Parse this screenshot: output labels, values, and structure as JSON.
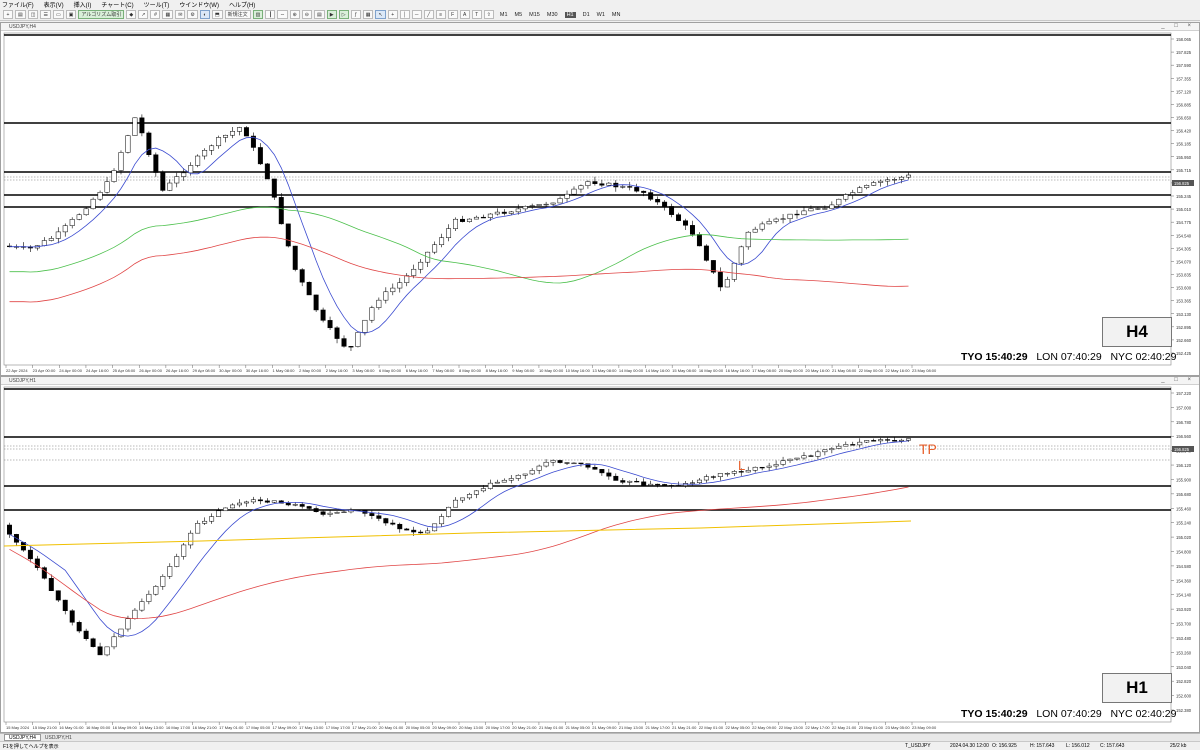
{
  "menu": [
    "ファイル(F)",
    "表示(V)",
    "挿入(I)",
    "チャート(C)",
    "ツール(T)",
    "ウインドウ(W)",
    "ヘルプ(H)"
  ],
  "toolbar": {
    "autotrade_label": "アルゴリズム取引",
    "ordernew_label": "新規注文",
    "timeframes": [
      "M1",
      "M5",
      "M15",
      "M30",
      "H1",
      "D1",
      "W1",
      "MN"
    ],
    "active_timeframe": "H1"
  },
  "top_chart": {
    "window_title": "USDJPY,H4",
    "timeframe_label": "H4",
    "clock": {
      "tyo_label": "TYO",
      "tyo_time": "15:40:29",
      "lon_label": "LON",
      "lon_time": "07:40:29",
      "nyc_label": "NYC",
      "nyc_time": "02:40:29"
    },
    "price_labels": [
      "158.065",
      "157.825",
      "157.590",
      "157.355",
      "157.120",
      "156.885",
      "156.650",
      "156.420",
      "156.185",
      "155.950",
      "155.715",
      "155.480",
      "155.245",
      "155.010",
      "154.775",
      "154.540",
      "154.305",
      "154.070",
      "153.835",
      "153.600",
      "153.365",
      "153.130",
      "152.895",
      "152.660",
      "152.425"
    ],
    "current_price": "156.825",
    "time_labels": [
      "22 Apr 2024",
      "23 Apr 00:00",
      "24 Apr 00:00",
      "24 Apr 16:00",
      "25 Apr 08:00",
      "26 Apr 00:00",
      "26 Apr 16:00",
      "29 Apr 08:00",
      "30 Apr 00:00",
      "30 Apr 16:00",
      "1 May 08:00",
      "2 May 00:00",
      "2 May 16:00",
      "3 May 08:00",
      "6 May 00:00",
      "6 May 16:00",
      "7 May 08:00",
      "8 May 00:00",
      "8 May 16:00",
      "9 May 08:00",
      "10 May 00:00",
      "10 May 16:00",
      "13 May 08:00",
      "14 May 00:00",
      "14 May 16:00",
      "15 May 08:00",
      "16 May 00:00",
      "16 May 16:00",
      "17 May 08:00",
      "20 May 00:00",
      "20 May 16:00",
      "21 May 08:00",
      "22 May 00:00",
      "22 May 16:00",
      "23 May 08:00"
    ]
  },
  "bottom_chart": {
    "window_title": "USDJPY,H1",
    "timeframe_label": "H1",
    "clock": {
      "tyo_label": "TYO",
      "tyo_time": "15:40:29",
      "lon_label": "LON",
      "lon_time": "07:40:29",
      "nyc_label": "NYC",
      "nyc_time": "02:40:29"
    },
    "price_labels": [
      "157.220",
      "157.000",
      "156.780",
      "156.560",
      "156.340",
      "156.120",
      "155.900",
      "155.680",
      "155.460",
      "155.240",
      "155.020",
      "154.800",
      "154.580",
      "154.360",
      "154.140",
      "153.920",
      "153.700",
      "153.480",
      "153.260",
      "153.040",
      "152.820",
      "152.600",
      "152.380"
    ],
    "current_price": "156.825",
    "tp_label": "TP",
    "l_label": "L",
    "time_labels": [
      "15 May 2024",
      "15 May 21:00",
      "16 May 01:00",
      "16 May 05:00",
      "16 May 09:00",
      "16 May 13:00",
      "16 May 17:00",
      "16 May 21:00",
      "17 May 01:00",
      "17 May 05:00",
      "17 May 09:00",
      "17 May 13:00",
      "17 May 17:00",
      "17 May 21:00",
      "20 May 01:00",
      "20 May 05:00",
      "20 May 09:00",
      "20 May 13:00",
      "20 May 17:00",
      "20 May 21:00",
      "21 May 01:00",
      "21 May 05:00",
      "21 May 09:00",
      "21 May 13:00",
      "21 May 17:00",
      "21 May 21:00",
      "22 May 01:00",
      "22 May 05:00",
      "22 May 09:00",
      "22 May 13:00",
      "22 May 17:00",
      "22 May 21:00",
      "23 May 01:00",
      "23 May 05:00",
      "23 May 09:00"
    ]
  },
  "tabs": [
    "USDJPY,H4",
    "USDJPY,H1"
  ],
  "active_tab": "USDJPY,H4",
  "status": {
    "help": "F1を押してヘルプを表示",
    "profile": "T_USDJPY",
    "datetime": "2024.04.30 12:00",
    "open": "O: 156.925",
    "high": "H: 157.643",
    "low": "L: 156.012",
    "close": "C: 157.643",
    "traffic": "25/2 kb"
  },
  "colors": {
    "ma_blue": "#3b4bd0",
    "ma_red": "#e04545",
    "ma_green": "#4cc04c",
    "ma_yellow": "#f0c000",
    "tp_color": "#e8602c"
  }
}
